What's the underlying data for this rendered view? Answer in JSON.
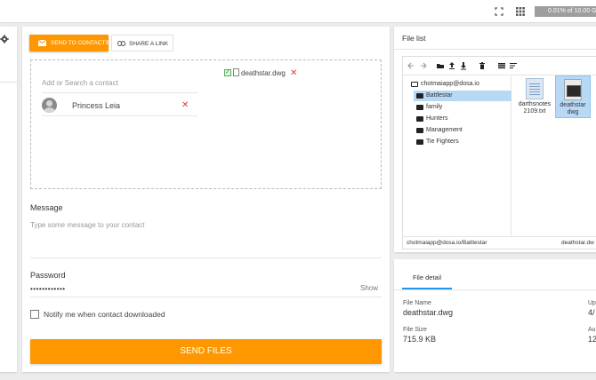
{
  "topbar": {
    "storage_text": "0.01% of 10.00 GB",
    "expand_icon": "expand-icon",
    "grid_icon": "grid-icon"
  },
  "sidebar": {
    "icon": "gear-icon"
  },
  "main": {
    "tab_send": "Send to contacts",
    "tab_share": "Share a link",
    "contact_placeholder": "Add or Search a contact",
    "contacts": [
      {
        "name": "Princess Leia"
      }
    ],
    "attachments": [
      {
        "name": "deathstar.dwg"
      }
    ],
    "message_label": "Message",
    "message_placeholder": "Type some message to your contact",
    "password_label": "Password",
    "password_value": "••••••••••••",
    "show_label": "Show",
    "notify_label": "Notify me when contact downloaded",
    "send_button": "Send files",
    "accent_color": "#ff9800"
  },
  "filelist": {
    "title": "File list",
    "tree": [
      {
        "label": "chotmaiapp@dosa.io",
        "type": "root"
      },
      {
        "label": "Battlestar",
        "selected": true
      },
      {
        "label": "family"
      },
      {
        "label": "Hunters"
      },
      {
        "label": "Management"
      },
      {
        "label": "Tie Fighters"
      }
    ],
    "files": [
      {
        "name": "darthsnotes2109.txt",
        "line1": "darthsnotes",
        "line2": "2109.txt",
        "kind": "txt"
      },
      {
        "name": "deathstar.dwg",
        "line1": "deathstar",
        "line2": "dwg",
        "kind": "dwg",
        "selected": true
      }
    ],
    "path": "chotmaiapp@dosa.io/Battlestar",
    "selected_file": "deathstar.dw"
  },
  "filedetail": {
    "tab": "File detail",
    "name_label": "File Name",
    "name_value": "deathstar.dwg",
    "size_label": "File Size",
    "size_value": "715.9 KB",
    "upload_label": "Up",
    "upload_value": "4/",
    "author_label": "Au",
    "author_value": "12"
  }
}
